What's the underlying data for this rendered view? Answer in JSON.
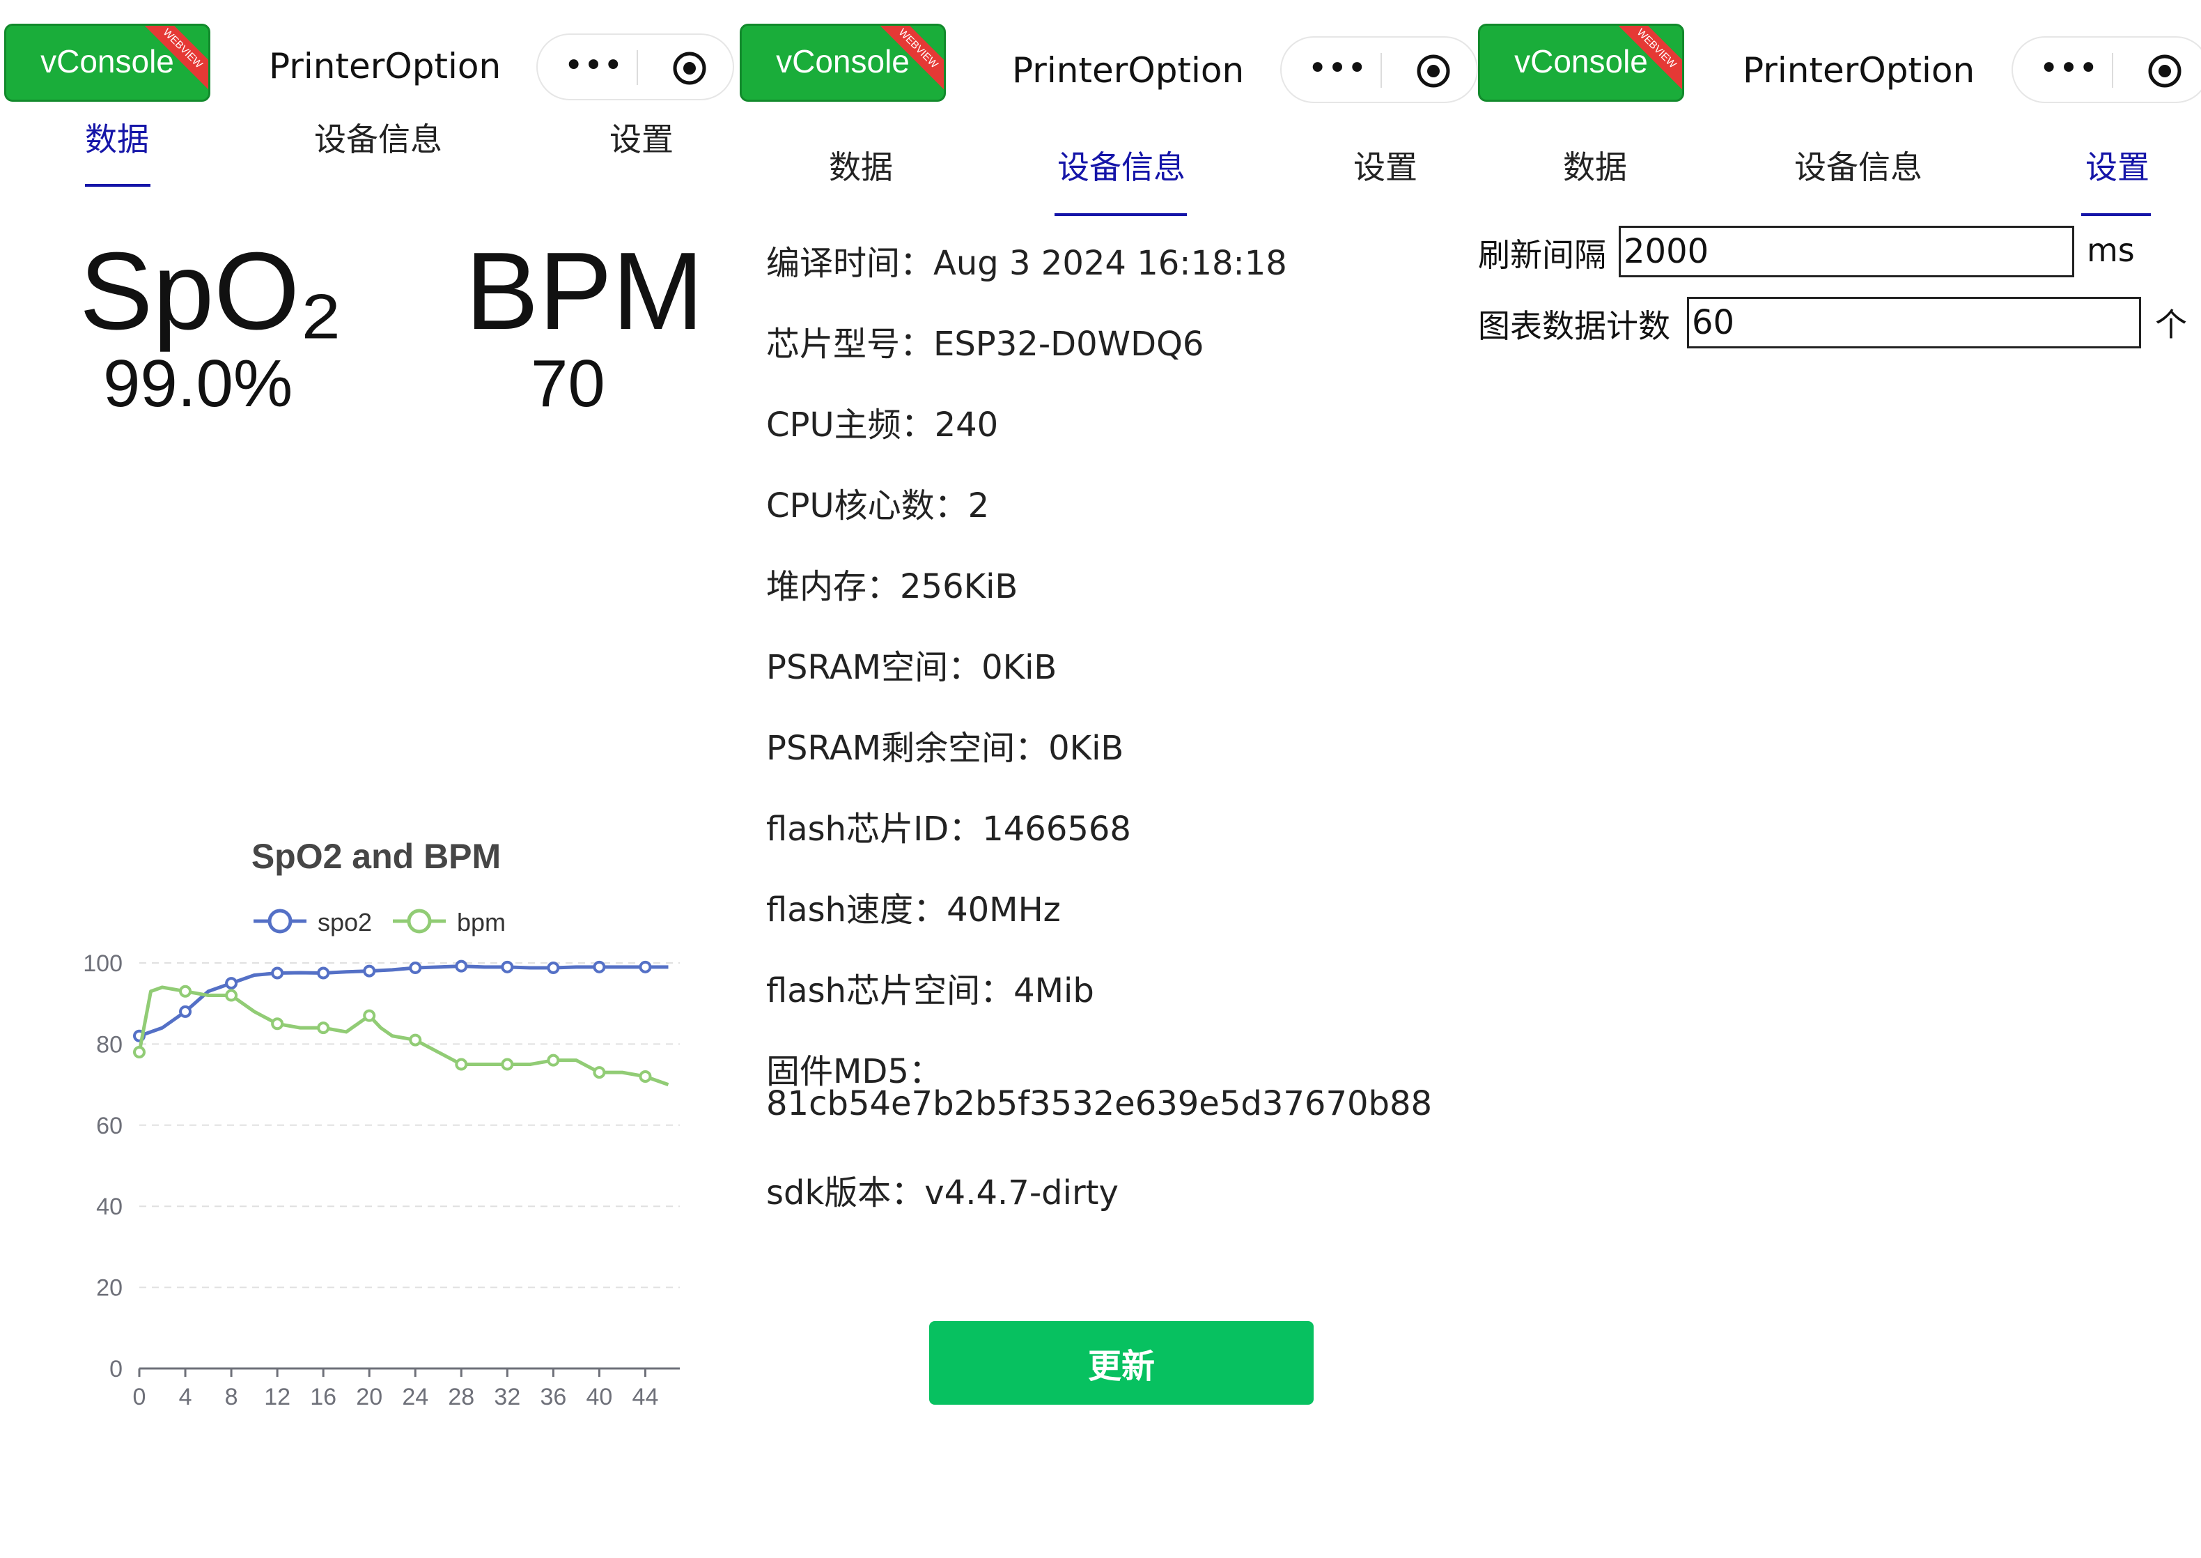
{
  "common": {
    "vconsole_label": "vConsole",
    "vconsole_badge": "WEBVIEW",
    "app_title": "PrinterOption",
    "more_icon": "•••",
    "tabs": [
      "数据",
      "设备信息",
      "设置"
    ]
  },
  "data_page": {
    "spo2_label": "SpO₂",
    "spo2_value": "99.0%",
    "bpm_label": "BPM",
    "bpm_value": "70"
  },
  "device_page": {
    "info": [
      "编译时间：Aug 3 2024 16:18:18",
      "芯片型号：ESP32-D0WDQ6",
      "CPU主频：240",
      "CPU核心数：2",
      "堆内存：256KiB",
      "PSRAM空间：0KiB",
      "PSRAM剩余空间：0KiB",
      "flash芯片ID：1466568",
      "flash速度：40MHz",
      "flash芯片空间：4Mib",
      "固件MD5：",
      "81cb54e7b2b5f3532e639e5d37670b88",
      "sdk版本：v4.4.7-dirty"
    ],
    "update_button": "更新"
  },
  "settings_page": {
    "refresh_label": "刷新间隔",
    "refresh_value": "2000",
    "refresh_unit": "ms",
    "count_label": "图表数据计数",
    "count_value": "60",
    "count_unit": "个"
  },
  "colors": {
    "tab_active": "#1515a8",
    "vconsole_bg": "#1aad3a",
    "update_btn": "#07c160",
    "spo2_series": "#5470c6",
    "bpm_series": "#91cc75"
  },
  "chart_data": {
    "type": "line",
    "title": "SpO2 and BPM",
    "legend_position": "top-center",
    "grid": true,
    "xlim": [
      0,
      47
    ],
    "ylim": [
      0,
      100
    ],
    "x_ticks": [
      0,
      4,
      8,
      12,
      16,
      20,
      24,
      28,
      32,
      36,
      40,
      44
    ],
    "y_ticks": [
      0,
      20,
      40,
      60,
      80,
      100
    ],
    "series": [
      {
        "name": "spo2",
        "color": "#5470c6",
        "x": [
          0,
          2,
          4,
          6,
          8,
          10,
          12,
          14,
          16,
          18,
          20,
          22,
          24,
          26,
          28,
          30,
          32,
          34,
          36,
          38,
          40,
          42,
          44,
          46
        ],
        "y": [
          82,
          84,
          88,
          93,
          95,
          97,
          97.5,
          97.6,
          97.5,
          97.8,
          98,
          98.3,
          98.8,
          99,
          99.2,
          99,
          99,
          98.8,
          98.8,
          99,
          99,
          99,
          99,
          99
        ],
        "markers_x": [
          0,
          4,
          8,
          12,
          16,
          20,
          24,
          28,
          32,
          36,
          40,
          44
        ]
      },
      {
        "name": "bpm",
        "color": "#91cc75",
        "x": [
          0,
          1,
          2,
          4,
          6,
          8,
          10,
          12,
          14,
          16,
          18,
          20,
          21,
          22,
          24,
          26,
          28,
          30,
          32,
          34,
          36,
          38,
          40,
          42,
          44,
          46
        ],
        "y": [
          78,
          93,
          94,
          93,
          92,
          92,
          88,
          85,
          84,
          84,
          83,
          87,
          84,
          82,
          81,
          78,
          75,
          75,
          75,
          75,
          76,
          76,
          73,
          73,
          72,
          70
        ],
        "markers_x": [
          0,
          4,
          8,
          12,
          16,
          20,
          24,
          28,
          32,
          36,
          40,
          44
        ]
      }
    ]
  }
}
